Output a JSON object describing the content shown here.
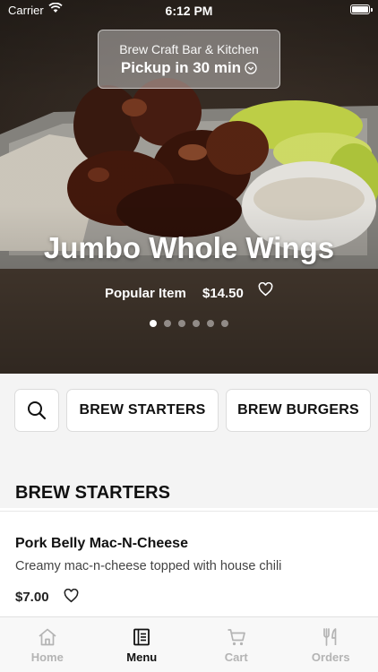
{
  "status_bar": {
    "carrier": "Carrier",
    "time": "6:12 PM"
  },
  "pickup": {
    "store_name": "Brew Craft Bar & Kitchen",
    "time_label": "Pickup in 30 min"
  },
  "featured": {
    "title": "Jumbo Whole Wings",
    "tag": "Popular Item",
    "price": "$14.50",
    "carousel_pages": 6,
    "active_page": 1
  },
  "categories": [
    "BREW STARTERS",
    "BREW BURGERS"
  ],
  "section": {
    "title": "BREW STARTERS"
  },
  "items": [
    {
      "name": "Pork Belly Mac-N-Cheese",
      "description": "Creamy mac-n-cheese topped with house chili",
      "price": "$7.00"
    }
  ],
  "tabs": [
    {
      "label": "Home",
      "icon": "home-icon",
      "active": false
    },
    {
      "label": "Menu",
      "icon": "menu-icon",
      "active": true
    },
    {
      "label": "Cart",
      "icon": "cart-icon",
      "active": false
    },
    {
      "label": "Orders",
      "icon": "fork-knife-icon",
      "active": false
    }
  ],
  "colors": {
    "tab_active": "#111111",
    "tab_inactive": "#b4b4b4",
    "category_bg": "#f4f4f4"
  }
}
